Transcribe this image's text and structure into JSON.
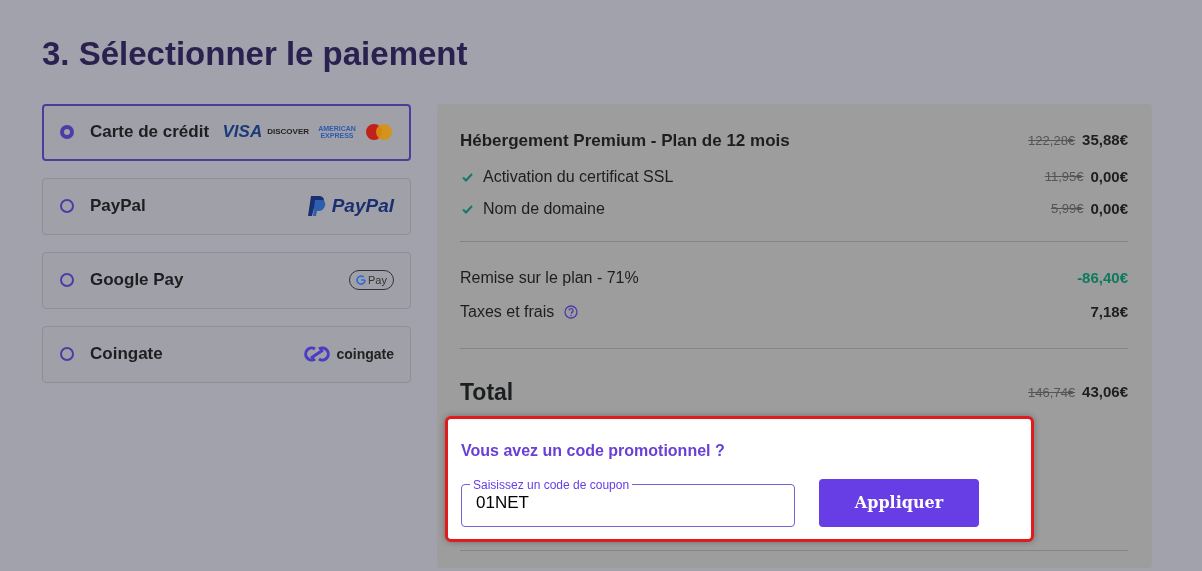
{
  "title": "3. Sélectionner le paiement",
  "payment_methods": [
    {
      "label": "Carte de crédit",
      "selected": true,
      "kind": "cards",
      "logos": [
        "VISA",
        "DISCOVER",
        "AMERICAN EXPRESS"
      ]
    },
    {
      "label": "PayPal",
      "selected": false,
      "kind": "paypal",
      "logos": [
        "PayPal"
      ]
    },
    {
      "label": "Google Pay",
      "selected": false,
      "kind": "gpay",
      "logos": [
        "Pay"
      ]
    },
    {
      "label": "Coingate",
      "selected": false,
      "kind": "coingate",
      "logos": [
        "coingate"
      ]
    }
  ],
  "summary": {
    "plan": {
      "name": "Hébergement Premium - Plan de 12 mois",
      "old_price": "122,28€",
      "price": "35,88€"
    },
    "items": [
      {
        "label": "Activation du certificat SSL",
        "old_price": "11,95€",
        "price": "0,00€"
      },
      {
        "label": "Nom de domaine",
        "old_price": "5,99€",
        "price": "0,00€"
      }
    ],
    "discount": {
      "label": "Remise sur le plan - 71%",
      "amount": "-86,40€"
    },
    "taxes": {
      "label": "Taxes et frais",
      "amount": "7,18€"
    },
    "total": {
      "label": "Total",
      "old_price": "146,74€",
      "price": "43,06€"
    }
  },
  "promo": {
    "heading": "Vous avez un code promotionnel ?",
    "field_label": "Saisissez un code de coupon",
    "value": "01NET",
    "button": "Appliquer"
  }
}
